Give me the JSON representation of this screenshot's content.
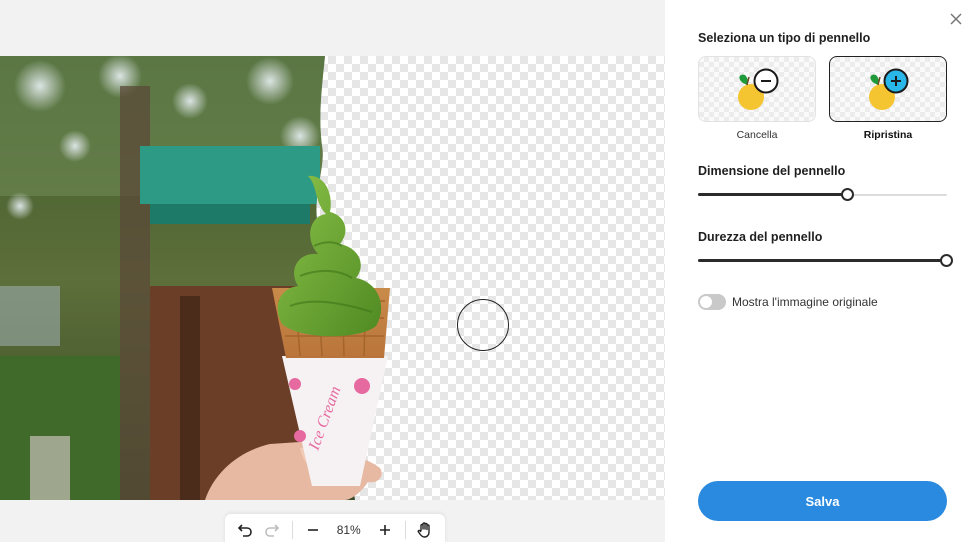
{
  "panel": {
    "brush_type_title": "Seleziona un tipo di pennello",
    "brush_options": [
      {
        "label": "Cancella",
        "icon": "minus-circle-icon",
        "selected": false
      },
      {
        "label": "Ripristina",
        "icon": "plus-circle-icon",
        "selected": true
      }
    ],
    "brush_size_title": "Dimensione del pennello",
    "brush_size_level": 0.6,
    "brush_hardness_title": "Durezza del pennello",
    "brush_hardness_level": 1.0,
    "show_original_label": "Mostra l'immagine originale",
    "show_original_on": false,
    "save_label": "Salva"
  },
  "toolbar": {
    "zoom_label": "81%",
    "undo_icon": "undo-icon",
    "redo_icon": "redo-icon",
    "zoom_out_icon": "minus-icon",
    "zoom_in_icon": "plus-icon",
    "pan_icon": "hand-icon"
  },
  "image": {
    "wrapper_text": "Ice Cream"
  },
  "colors": {
    "accent": "#2a8ae0",
    "restore_icon": "#29b6e8"
  }
}
